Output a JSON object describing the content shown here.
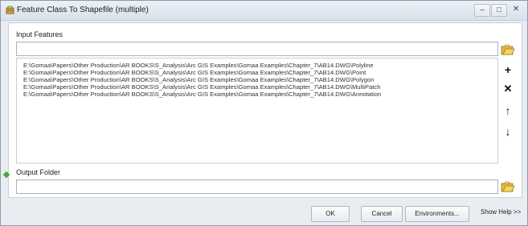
{
  "window": {
    "title": "Feature Class To Shapefile (multiple)",
    "minimize": "–",
    "maximize": "□",
    "close": "✕"
  },
  "input_features": {
    "label": "Input Features",
    "value": "",
    "items": [
      "E:\\Gomaa\\Papers\\Other Production\\AR BOOKS\\S_Analysis\\Arc GIS Examples\\Gomaa Examples\\Chapter_7\\AB14.DWG\\Polyline",
      "E:\\Gomaa\\Papers\\Other Production\\AR BOOKS\\S_Analysis\\Arc GIS Examples\\Gomaa Examples\\Chapter_7\\AB14.DWG\\Point",
      "E:\\Gomaa\\Papers\\Other Production\\AR BOOKS\\S_Analysis\\Arc GIS Examples\\Gomaa Examples\\Chapter_7\\AB14.DWG\\Polygon",
      "E:\\Gomaa\\Papers\\Other Production\\AR BOOKS\\S_Analysis\\Arc GIS Examples\\Gomaa Examples\\Chapter_7\\AB14.DWG\\MultiPatch",
      "E:\\Gomaa\\Papers\\Other Production\\AR BOOKS\\S_Analysis\\Arc GIS Examples\\Gomaa Examples\\Chapter_7\\AB14.DWG\\Annotation"
    ],
    "side_buttons": {
      "add": "+",
      "remove": "✕",
      "up": "↑",
      "down": "↓"
    }
  },
  "output_folder": {
    "label": "Output Folder",
    "value": ""
  },
  "footer": {
    "ok": "OK",
    "cancel": "Cancel",
    "environments": "Environments...",
    "show_help": "Show Help >>"
  },
  "icons": {
    "app": "toolbox-icon",
    "browse": "open-folder-icon",
    "required": "green-dot-icon"
  },
  "colors": {
    "folder_yellow": "#e6b93a",
    "required_green": "#3fae2a"
  }
}
